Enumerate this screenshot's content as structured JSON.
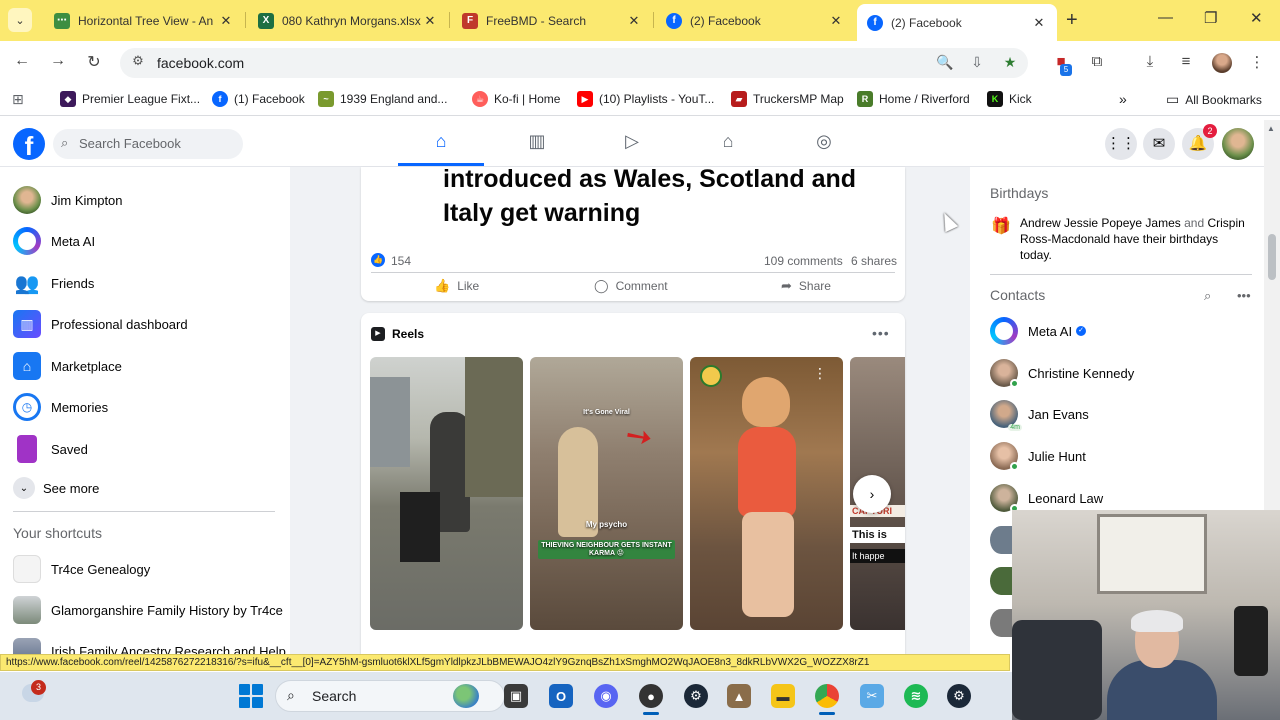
{
  "browser": {
    "tabs": [
      {
        "title": "Horizontal Tree View - An",
        "favicon": "tree-favicon",
        "color": "#3e8e41"
      },
      {
        "title": "080 Kathryn Morgans.xlsx",
        "favicon": "excel-favicon",
        "color": "#1d6f42"
      },
      {
        "title": "FreeBMD - Search",
        "favicon": "freebmd-favicon",
        "color": "#c0392b"
      },
      {
        "title": "(2) Facebook",
        "favicon": "facebook-favicon",
        "color": "#0866ff"
      },
      {
        "title": "(2) Facebook",
        "favicon": "facebook-favicon",
        "color": "#0866ff",
        "active": true
      }
    ],
    "url": "facebook.com",
    "extension_badge": "5",
    "bookmarks": [
      {
        "label": "Premier League Fixt...",
        "color": "#3d195b"
      },
      {
        "label": "(1) Facebook",
        "color": "#0866ff"
      },
      {
        "label": "1939 England and...",
        "color": "#7a9a2e"
      },
      {
        "label": "Ko-fi | Home",
        "color": "#ff5e5b"
      },
      {
        "label": "(10) Playlists - YouT...",
        "color": "#ff0000"
      },
      {
        "label": "TruckersMP Map",
        "color": "#b71c1c"
      },
      {
        "label": "Home / Riverford",
        "color": "#4a7c2a"
      },
      {
        "label": "Kick",
        "color": "#53fc18"
      }
    ],
    "all_bookmarks": "All Bookmarks",
    "status_url": "https://www.facebook.com/reel/1425876272218316/?s=ifu&__cft__[0]=AZY5hM-gsmluot6klXLf5gmYldlpkzJLbBMEWAJO4zlY9GznqBsZh1xSmghMO2WqJAOE8n3_8dkRLbVWX2G_WOZZX8rZ1"
  },
  "facebook": {
    "brand_color": "#0866ff",
    "search_placeholder": "Search Facebook",
    "notification_count": "2",
    "sidebar": [
      {
        "label": "Jim Kimpton",
        "icon": "user-avatar"
      },
      {
        "label": "Meta AI",
        "icon": "meta-ai-icon"
      },
      {
        "label": "Friends",
        "icon": "friends-icon"
      },
      {
        "label": "Professional dashboard",
        "icon": "dashboard-icon"
      },
      {
        "label": "Marketplace",
        "icon": "marketplace-icon"
      },
      {
        "label": "Memories",
        "icon": "memories-icon"
      },
      {
        "label": "Saved",
        "icon": "saved-icon"
      }
    ],
    "see_more": "See more",
    "shortcuts_title": "Your shortcuts",
    "shortcuts": [
      {
        "label": "Tr4ce Genealogy"
      },
      {
        "label": "Glamorganshire Family History by Tr4ce"
      },
      {
        "label": "Irish Family Ancestry Research and Help"
      }
    ],
    "post": {
      "headline": "introduced as Wales, Scotland and Italy get warning",
      "likes": "154",
      "comments": "109 comments",
      "shares": "6 shares",
      "actions": {
        "like": "Like",
        "comment": "Comment",
        "share": "Share"
      }
    },
    "reels": {
      "title": "Reels",
      "items": [
        {
          "caption": ""
        },
        {
          "caption": "My psycho",
          "caption2": "THIEVING NEIGHBOUR GETS INSTANT KARMA 😡",
          "overlay": "It's Gone Viral"
        },
        {
          "caption": ""
        },
        {
          "caption": "This is",
          "caption2": "It happe",
          "overlay": "CAPTURI"
        }
      ]
    },
    "birthdays": {
      "title": "Birthdays",
      "name1": "Andrew Jessie Popeye James",
      "and": "and",
      "name2": "Crispin Ross-Macdonald",
      "suffix": "have their birthdays today."
    },
    "contacts_title": "Contacts",
    "contacts": [
      {
        "name": "Meta AI",
        "verified": true
      },
      {
        "name": "Christine Kennedy",
        "online": true
      },
      {
        "name": "Jan Evans",
        "away": "4m"
      },
      {
        "name": "Julie Hunt",
        "online": true
      },
      {
        "name": "Leonard Law",
        "online": true
      }
    ]
  },
  "taskbar": {
    "search_placeholder": "Search",
    "notification_badge": "3"
  }
}
